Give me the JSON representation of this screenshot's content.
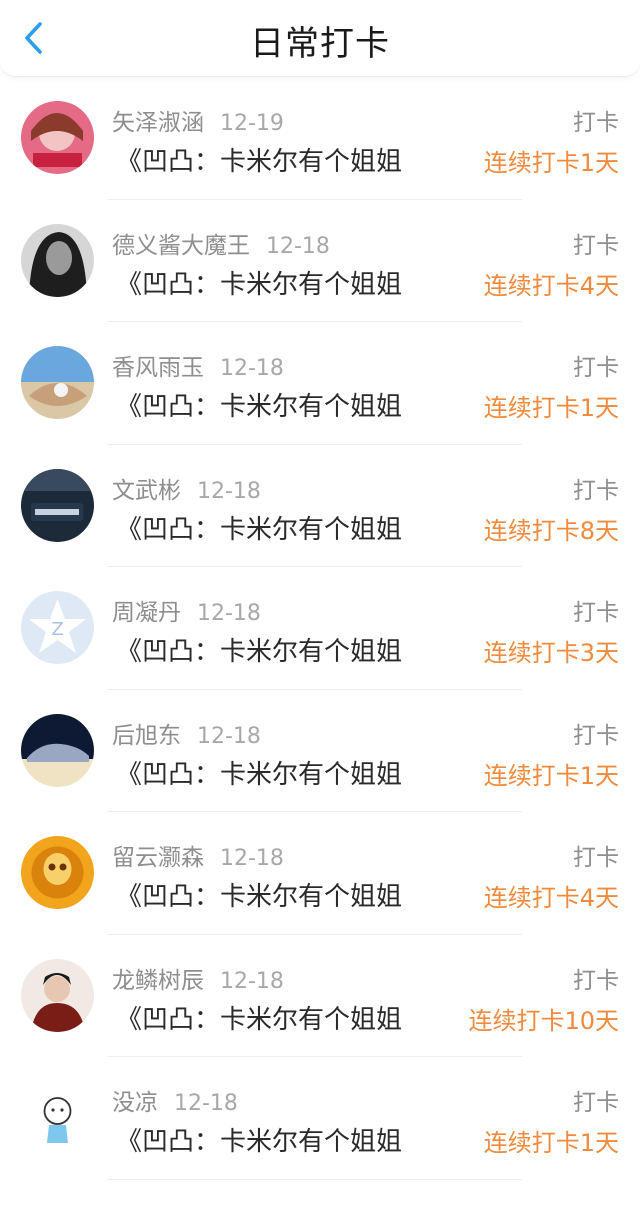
{
  "header": {
    "title": "日常打卡"
  },
  "colors": {
    "accent_blue": "#2c9cf0",
    "streak_orange": "#f08a3c"
  },
  "rows": [
    {
      "name": "矢泽淑涵",
      "date": "12-19",
      "action": "打卡",
      "book": "《凹凸：卡米尔有个姐姐",
      "streak": "连续打卡1天"
    },
    {
      "name": "德义酱大魔王",
      "date": "12-18",
      "action": "打卡",
      "book": "《凹凸：卡米尔有个姐姐",
      "streak": "连续打卡4天"
    },
    {
      "name": "香风雨玉",
      "date": "12-18",
      "action": "打卡",
      "book": "《凹凸：卡米尔有个姐姐",
      "streak": "连续打卡1天"
    },
    {
      "name": "文武彬",
      "date": "12-18",
      "action": "打卡",
      "book": "《凹凸：卡米尔有个姐姐",
      "streak": "连续打卡8天"
    },
    {
      "name": "周凝丹",
      "date": "12-18",
      "action": "打卡",
      "book": "《凹凸：卡米尔有个姐姐",
      "streak": "连续打卡3天"
    },
    {
      "name": "后旭东",
      "date": "12-18",
      "action": "打卡",
      "book": "《凹凸：卡米尔有个姐姐",
      "streak": "连续打卡1天"
    },
    {
      "name": "留云灏森",
      "date": "12-18",
      "action": "打卡",
      "book": "《凹凸：卡米尔有个姐姐",
      "streak": "连续打卡4天"
    },
    {
      "name": "龙鳞树辰",
      "date": "12-18",
      "action": "打卡",
      "book": "《凹凸：卡米尔有个姐姐",
      "streak": "连续打卡10天"
    },
    {
      "name": "没凉",
      "date": "12-18",
      "action": "打卡",
      "book": "《凹凸：卡米尔有个姐姐",
      "streak": "连续打卡1天"
    }
  ]
}
